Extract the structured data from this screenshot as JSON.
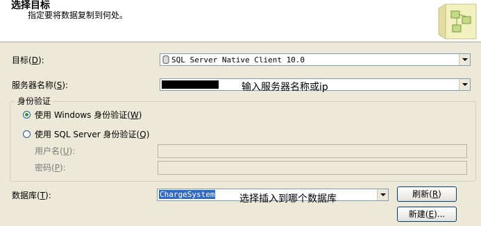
{
  "header": {
    "title": "选择目标",
    "subtitle": "指定要将数据复制到何处。"
  },
  "target": {
    "label": "目标(",
    "key": "D",
    "suffix": "):",
    "value": "SQL Server Native Client 10.0"
  },
  "server": {
    "label": "服务器名称(",
    "key": "S",
    "suffix": "):",
    "annotation": "输入服务器名称或ip"
  },
  "auth": {
    "legend": "身份验证",
    "windows": {
      "label": "使用 Windows 身份验证(",
      "key": "W",
      "suffix": ")",
      "checked": true
    },
    "sql": {
      "label": "使用 SQL Server 身份验证(",
      "key": "Q",
      "suffix": ")",
      "checked": false
    },
    "username": {
      "label": "用户名(",
      "key": "U",
      "suffix": "):"
    },
    "password": {
      "label": "密码(",
      "key": "P",
      "suffix": "):"
    }
  },
  "database": {
    "label": "数据库(",
    "key": "T",
    "suffix": "):",
    "value": "ChargeSystem",
    "annotation": "选择插入到哪个数据库"
  },
  "buttons": {
    "refresh": {
      "label": "刷新(",
      "key": "R",
      "suffix": ")"
    },
    "new": {
      "label": "新建(",
      "key": "E",
      "suffix": ")..."
    }
  }
}
